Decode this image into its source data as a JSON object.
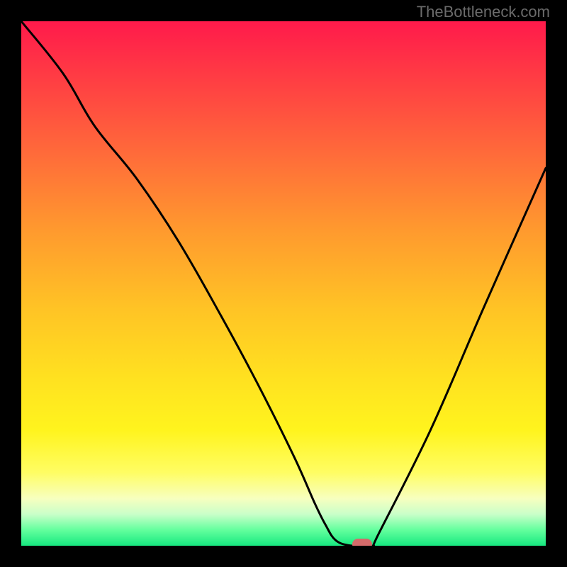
{
  "watermark": "TheBottleneck.com",
  "chart_data": {
    "type": "line",
    "title": "",
    "xlabel": "",
    "ylabel": "",
    "xlim": [
      0,
      100
    ],
    "ylim": [
      0,
      100
    ],
    "grid": false,
    "series": [
      {
        "name": "bottleneck-curve",
        "x": [
          0,
          8,
          14,
          22,
          30,
          38,
          45,
          52,
          56,
          58,
          60,
          63,
          67,
          68,
          78,
          88,
          100
        ],
        "values": [
          100,
          90,
          80,
          70,
          58,
          44,
          31,
          17,
          8,
          4,
          1,
          0,
          0,
          2,
          22,
          45,
          72
        ]
      }
    ],
    "optimal_marker": {
      "x": 65,
      "y": 0
    },
    "gradient_stops": [
      {
        "pos": 0,
        "color": "#ff1a4b"
      },
      {
        "pos": 10,
        "color": "#ff3a44"
      },
      {
        "pos": 25,
        "color": "#ff6a3a"
      },
      {
        "pos": 40,
        "color": "#ff9a2e"
      },
      {
        "pos": 55,
        "color": "#ffc425"
      },
      {
        "pos": 68,
        "color": "#ffe120"
      },
      {
        "pos": 78,
        "color": "#fff41e"
      },
      {
        "pos": 86,
        "color": "#fffd63"
      },
      {
        "pos": 91,
        "color": "#f7ffbf"
      },
      {
        "pos": 94,
        "color": "#c9ffc9"
      },
      {
        "pos": 97,
        "color": "#63ff9d"
      },
      {
        "pos": 100,
        "color": "#17e880"
      }
    ]
  }
}
